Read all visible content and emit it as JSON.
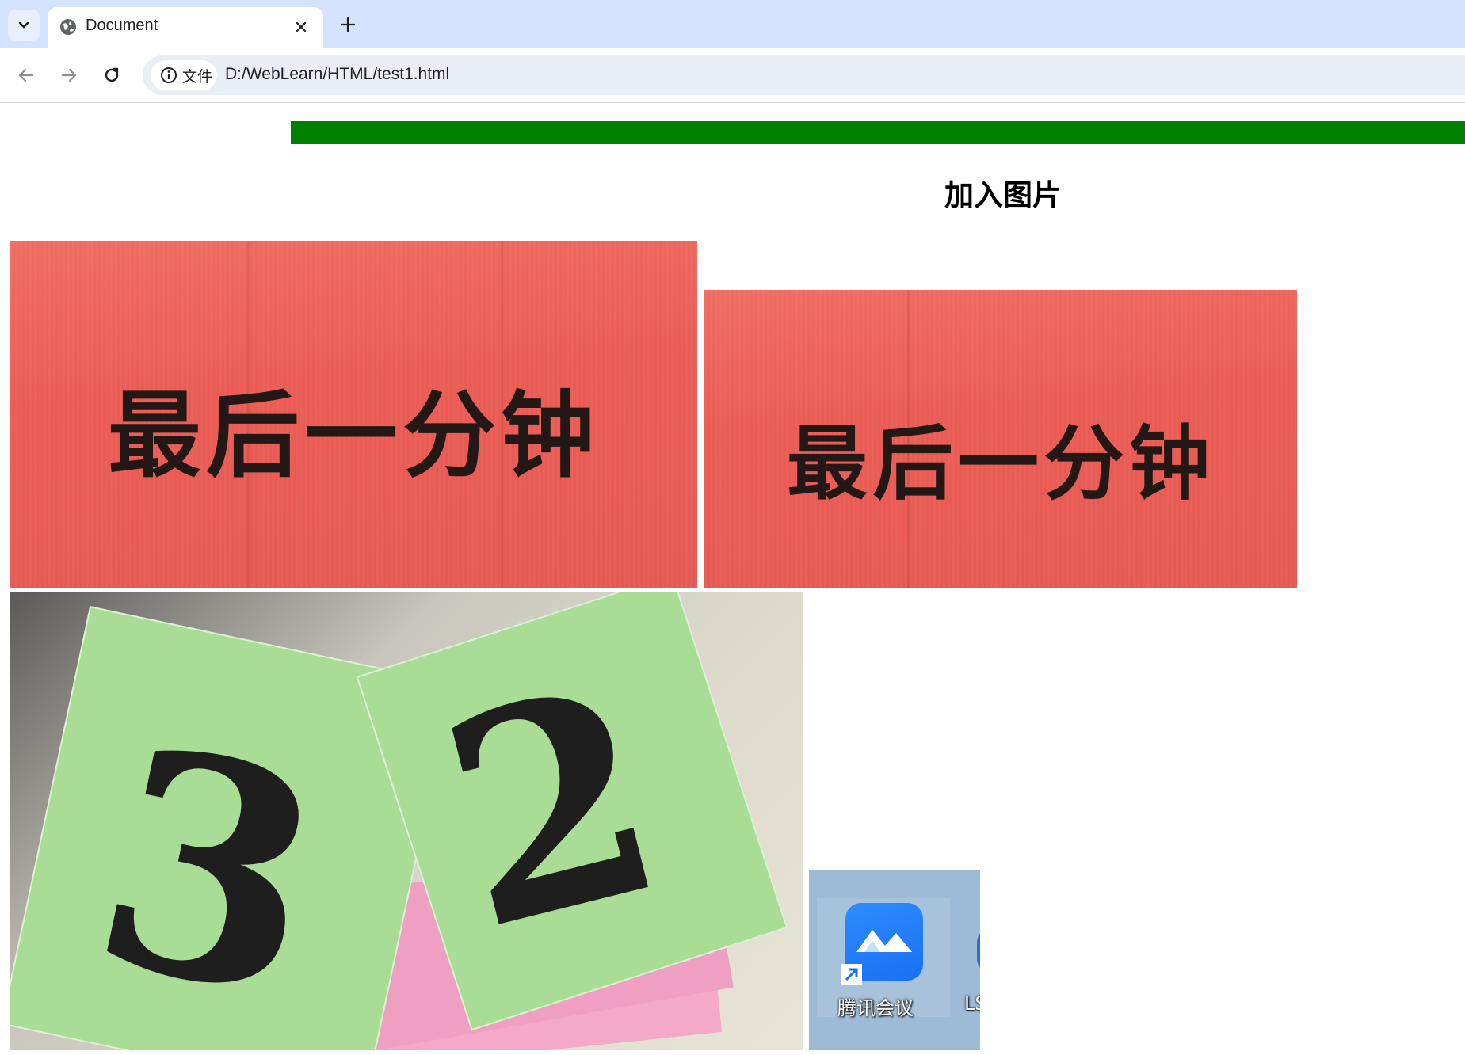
{
  "browser": {
    "tab": {
      "title": "Document",
      "favicon": "globe-icon"
    },
    "toolbar": {
      "back_icon": "arrow-left-icon",
      "forward_icon": "arrow-right-icon",
      "reload_icon": "reload-icon",
      "site_info_label": "文件",
      "url": "D:/WebLearn/HTML/test1.html"
    }
  },
  "page": {
    "heading": "加入图片",
    "bar_color": "#008000",
    "images": [
      {
        "text": "最后一分钟"
      },
      {
        "text": "最后一分钟"
      },
      {
        "numbers": [
          "3",
          "2"
        ]
      },
      {
        "app_label": "腾讯会议",
        "clipped_label": "LS"
      }
    ]
  }
}
